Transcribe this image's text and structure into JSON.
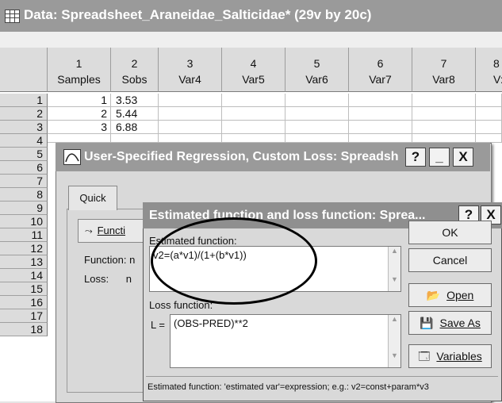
{
  "main": {
    "title": "Data: Spreadsheet_Araneidae_Salticidae* (29v by 20c)"
  },
  "sheet": {
    "columns": [
      {
        "num": "1",
        "name": "Samples"
      },
      {
        "num": "2",
        "name": "Sobs"
      },
      {
        "num": "3",
        "name": "Var4"
      },
      {
        "num": "4",
        "name": "Var5"
      },
      {
        "num": "5",
        "name": "Var6"
      },
      {
        "num": "6",
        "name": "Var7"
      },
      {
        "num": "7",
        "name": "Var8"
      },
      {
        "num": "8",
        "name": "V:"
      }
    ],
    "rows": [
      "1",
      "2",
      "3",
      "4",
      "5",
      "6",
      "7",
      "8",
      "9",
      "10",
      "11",
      "12",
      "13",
      "14",
      "15",
      "16",
      "17",
      "18"
    ],
    "cells": [
      [
        "1",
        "3.53"
      ],
      [
        "2",
        "5.44"
      ],
      [
        "3",
        "6.88"
      ]
    ]
  },
  "regression_dialog": {
    "title": "User-Specified Regression, Custom Loss: Spreadsh",
    "help": "?",
    "minimize": "_",
    "close": "X",
    "tab": "Quick",
    "function_button": "Functi",
    "function_label": "Function: n",
    "loss_label": "Loss:      n"
  },
  "estimation_dialog": {
    "title": "Estimated function and loss function: Sprea...",
    "help": "?",
    "close": "X",
    "estimated_label": "Estimated function:",
    "estimated_value": "v2=(a*v1)/(1+(b*v1))",
    "loss_label": "Loss function:",
    "loss_prefix": "L =",
    "loss_value": "(OBS-PRED)**2",
    "ok": "OK",
    "cancel": "Cancel",
    "open": "Open",
    "save_as": "Save As",
    "variables": "Variables",
    "status": "Estimated function: 'estimated var'=expression; e.g.: v2=const+param*v3"
  }
}
